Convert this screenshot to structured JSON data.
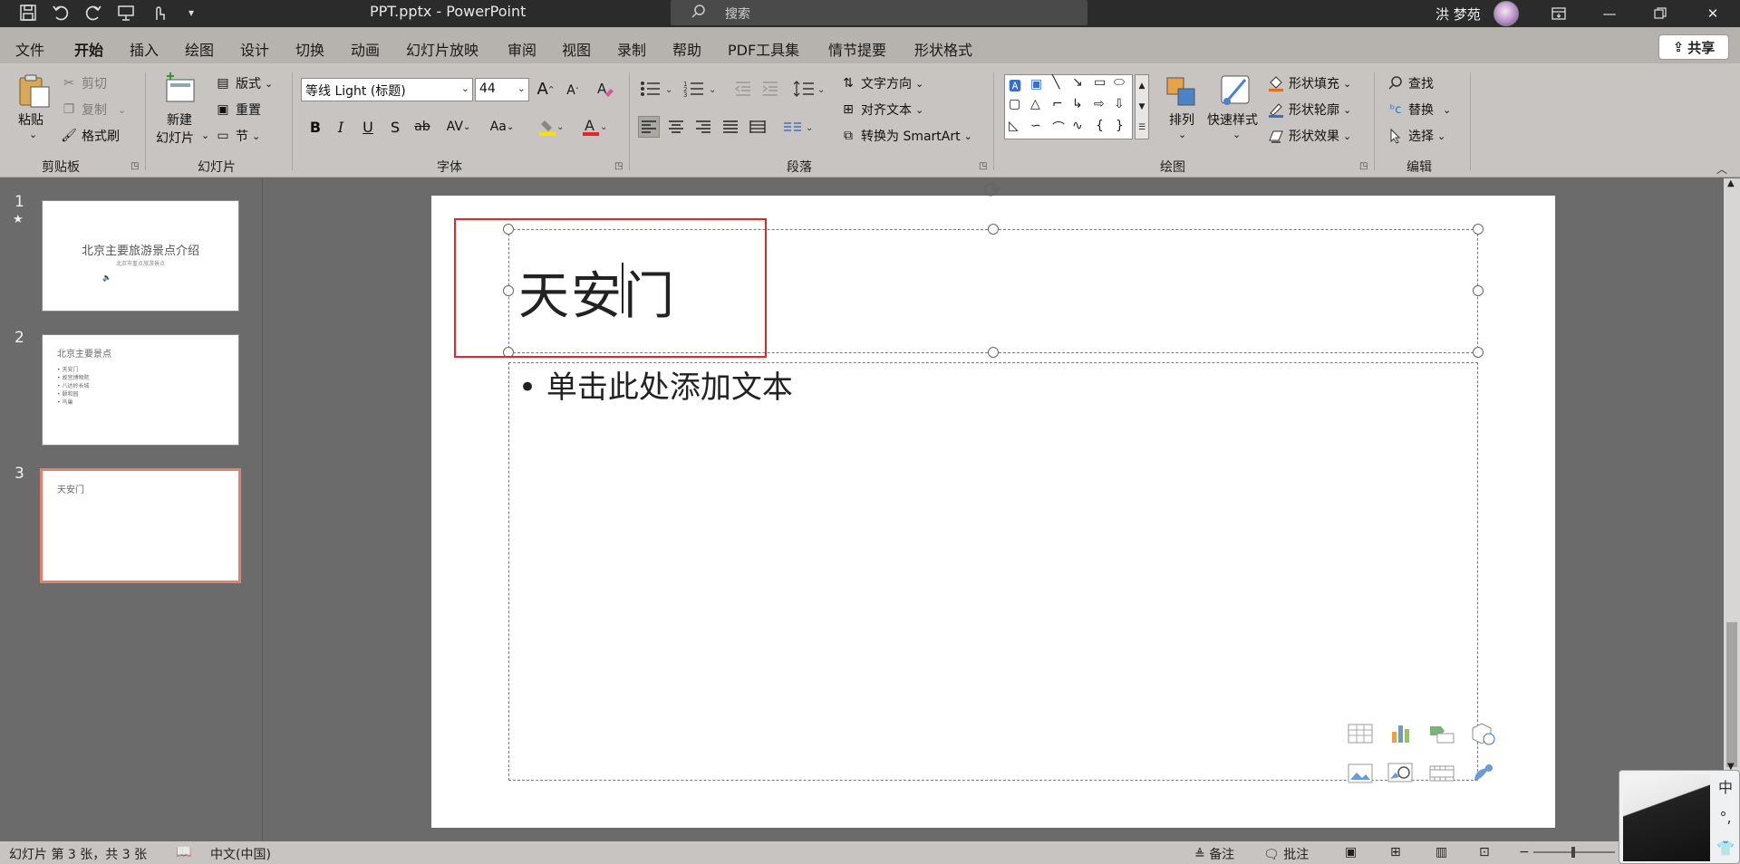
{
  "titlebar": {
    "doc_title": "PPT.pptx  -  PowerPoint",
    "search_placeholder": "搜索",
    "user_name": "洪 梦苑",
    "icons": [
      "save-icon",
      "undo-icon",
      "redo-icon",
      "present-icon",
      "touch-mode-icon",
      "customize-qat-icon"
    ]
  },
  "menu": {
    "tabs": [
      "文件",
      "开始",
      "插入",
      "绘图",
      "设计",
      "切换",
      "动画",
      "幻灯片放映",
      "审阅",
      "视图",
      "录制",
      "帮助",
      "PDF工具集",
      "情节提要",
      "形状格式"
    ],
    "active": "开始",
    "share": "共享"
  },
  "ribbon": {
    "clipboard": {
      "paste": "粘贴",
      "cut": "剪切",
      "copy": "复制",
      "format_painter": "格式刷",
      "label": "剪贴板"
    },
    "slides": {
      "new_slide_line1": "新建",
      "new_slide_line2": "幻灯片",
      "layout": "版式",
      "reset": "重置",
      "section": "节",
      "label": "幻灯片"
    },
    "font": {
      "family": "等线 Light (标题)",
      "size": "44",
      "bold": "B",
      "italic": "I",
      "underline": "U",
      "shadow": "S",
      "strike": "ab",
      "spacing": "AV",
      "case": "Aa",
      "grow": "A",
      "shrink": "A",
      "label": "字体"
    },
    "paragraph": {
      "text_direction": "文字方向",
      "align_text": "对齐文本",
      "smartart": "转换为 SmartArt",
      "label": "段落"
    },
    "drawing": {
      "arrange": "排列",
      "quick_styles": "快速样式",
      "shape_fill": "形状填充",
      "shape_outline": "形状轮廓",
      "shape_effects": "形状效果",
      "label": "绘图"
    },
    "editing": {
      "find": "查找",
      "replace": "替换",
      "select": "选择",
      "label": "编辑"
    }
  },
  "thumbnails": [
    {
      "num": "1",
      "title": "北京主要旅游景点介绍",
      "subtitle": "北京市重点旅游景点",
      "has_star": true
    },
    {
      "num": "2",
      "title": "北京主要景点",
      "bullets": [
        "• 天安门",
        "• 故宫博物院",
        "• 八达岭长城",
        "• 颐和园",
        "• 鸟巢"
      ]
    },
    {
      "num": "3",
      "title": "天安门",
      "selected": true
    }
  ],
  "slide": {
    "title": "天安门",
    "body_placeholder": "• 单击此处添加文本"
  },
  "statusbar": {
    "slide_info": "幻灯片 第 3 张，共 3 张",
    "language": "中文(中国)",
    "notes": "备注",
    "comments": "批注"
  },
  "ime": {
    "mode": "中",
    "punct": "°,",
    "skin": "👕"
  },
  "colors": {
    "accent": "#b7472a",
    "selection_border": "#e4806a",
    "highlight_box": "#e0262f"
  }
}
